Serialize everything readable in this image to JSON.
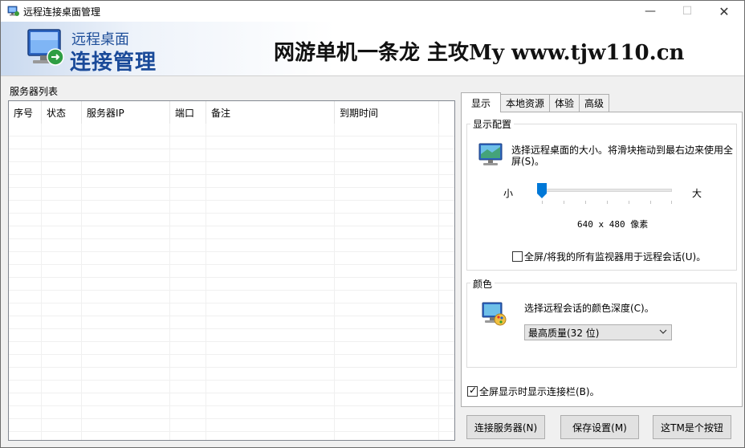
{
  "window": {
    "title": "远程连接桌面管理",
    "controls": {
      "minimize": "—",
      "maximize": "☐",
      "close": "✕"
    }
  },
  "banner": {
    "subtitle": "远程桌面",
    "title": "连接管理",
    "promo": "网游单机一条龙 主攻My www.tjw110.cn"
  },
  "server_list": {
    "label": "服务器列表",
    "columns": [
      "序号",
      "状态",
      "服务器IP",
      "端口",
      "备注",
      "到期时间"
    ]
  },
  "tabs": [
    {
      "label": "显示",
      "active": true
    },
    {
      "label": "本地资源",
      "active": false
    },
    {
      "label": "体验",
      "active": false
    },
    {
      "label": "高级",
      "active": false
    }
  ],
  "display_config": {
    "group_title": "显示配置",
    "description": "选择远程桌面的大小。将滑块拖动到最右边来使用全屏(S)。",
    "slider_min_label": "小",
    "slider_max_label": "大",
    "slider_value": 0,
    "resolution_text": "640 x 480 像素",
    "multi_monitor_label": "全屏/将我的所有监视器用于远程会话(U)。",
    "multi_monitor_checked": false
  },
  "color": {
    "group_title": "颜色",
    "description": "选择远程会话的颜色深度(C)。",
    "selected": "最高质量(32 位)"
  },
  "connection_bar": {
    "label": "全屏显示时显示连接栏(B)。",
    "checked": true
  },
  "buttons": {
    "connect": "连接服务器(N)",
    "save": "保存设置(M)",
    "other": "这TM是个按钮"
  },
  "colors": {
    "banner_text": "#1a4a99",
    "window_bg": "#f0f0f0",
    "slider_thumb": "#0078d7"
  },
  "icons": {
    "app": "remote-desktop-icon",
    "display": "monitor-icon",
    "color": "color-palette-monitor-icon"
  }
}
